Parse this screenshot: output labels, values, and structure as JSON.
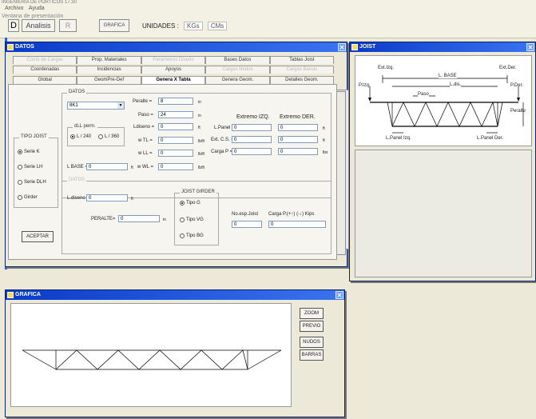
{
  "app": {
    "title": "INGENIERIA DE PORTICOS 17.30",
    "menu": [
      "Archivo",
      "Ayuda"
    ],
    "subtitle": "Ventana de presentación"
  },
  "toolbar": {
    "d_label": "D",
    "analisis_label": "Analisis",
    "r_label": "R",
    "grafica_label": "GRAFICA",
    "unidades_label": "UNIDADES :",
    "unit_force": "KGs",
    "unit_length": "CMs"
  },
  "datos_window": {
    "title": "DATOS",
    "tabs_row1": [
      "Comb de Cargas",
      "Prop. Materiales",
      "Parametros Diseño",
      "Bases Datos",
      "Tablas Joist"
    ],
    "tabs_row2": [
      "Coordenadas",
      "Incidencias",
      "Apoyos",
      "Cargas Nodos",
      "Cargas Barras"
    ],
    "tabs_row3": [
      "Global",
      "GeomPre-Def",
      "Genera X Tabla",
      "Genera Geom.",
      "Detalles Geom."
    ],
    "tipo_joist": {
      "title": "TIPO JOIST",
      "options": [
        "Serie K",
        "Serie LH",
        "Serie DLH",
        "Girder"
      ],
      "selected_index": 0
    },
    "datos_group": {
      "title": "DATOS",
      "combo_value": "8K1",
      "dll_title": "dLL perm.",
      "dll_options": [
        "L / 240",
        "L / 360"
      ],
      "dll_selected_index": 0,
      "lbase_label": "L BASE =",
      "lbase_value": "0",
      "lbase_unit": "ft",
      "peralte_label": "Peralte =",
      "peralte_value": "8",
      "peralte_unit": "in",
      "paso_label": "Paso =",
      "paso_value": "24",
      "paso_unit": "in",
      "ldiseno_label": "Ldiseno =",
      "ldiseno_value": "0",
      "ldiseno_unit": "ft",
      "wtl_label": "w TL =",
      "wtl_value": "0",
      "wtl_unit": "lb/ft",
      "wll_label": "w LL =",
      "wll_value": "0",
      "wll_unit": "lb/ft",
      "wwl_label": "w WL =",
      "wwl_value": "0",
      "wwl_unit": "lb/ft",
      "extremo_izq": "Extremo IZQ.",
      "extremo_der": "Extremo DER.",
      "lpanel_label": "L.Panel =",
      "lpanel_izq": "0",
      "lpanel_der": "0",
      "lpanel_unit": "ft",
      "extcs_label": "Ext. C.S. =",
      "extcs_izq": "0",
      "extcs_der": "0",
      "extcs_unit": "ft",
      "cargap_label": "Carga P =",
      "cargap_izq": "0",
      "cargap_der": "0",
      "cargap_unit": "lbs"
    },
    "datos2_group": {
      "title": "DATOS",
      "ldiseno_label": "L.diseno",
      "ldiseno_value": "0",
      "ldiseno_unit": "ft",
      "peralte_label": "PERALTE=",
      "peralte_value": "0",
      "peralte_unit": "in",
      "girder_title": "JOIST GIRDER",
      "girder_options": [
        "Tipo G",
        "Tipo VG",
        "Tipo BG"
      ],
      "girder_selected_index": 0,
      "noesp_label": "No.esp.Joist",
      "noesp_value": "0",
      "carga_label": "Carga P.(+↑)  (-↓) Kips",
      "carga_value": "0"
    },
    "aceptar_label": "ACEPTAR"
  },
  "joist_window": {
    "title": "JOIST",
    "labels": {
      "ext_izq": "Ext.Izq.",
      "ext_der": "Ext.Der.",
      "l_base": "L. BASE",
      "l_dis": "L.dis.",
      "p_izq": "P.Izq.",
      "p_der": "P.Der.",
      "paso": "Paso",
      "peralte": "Peralte",
      "l_panel_izq": "L.Panel Izq.",
      "l_panel_der": "L.Panel Der."
    }
  },
  "grafica_window": {
    "title": "GRAFICA",
    "buttons": [
      "ZOOM",
      "PREVIO",
      "NUDOS",
      "BARRAS"
    ]
  },
  "colors": {
    "titlebar": "#0a3ac8",
    "window_bg": "#ece9d8",
    "panel_bg": "#f6f5f0"
  }
}
